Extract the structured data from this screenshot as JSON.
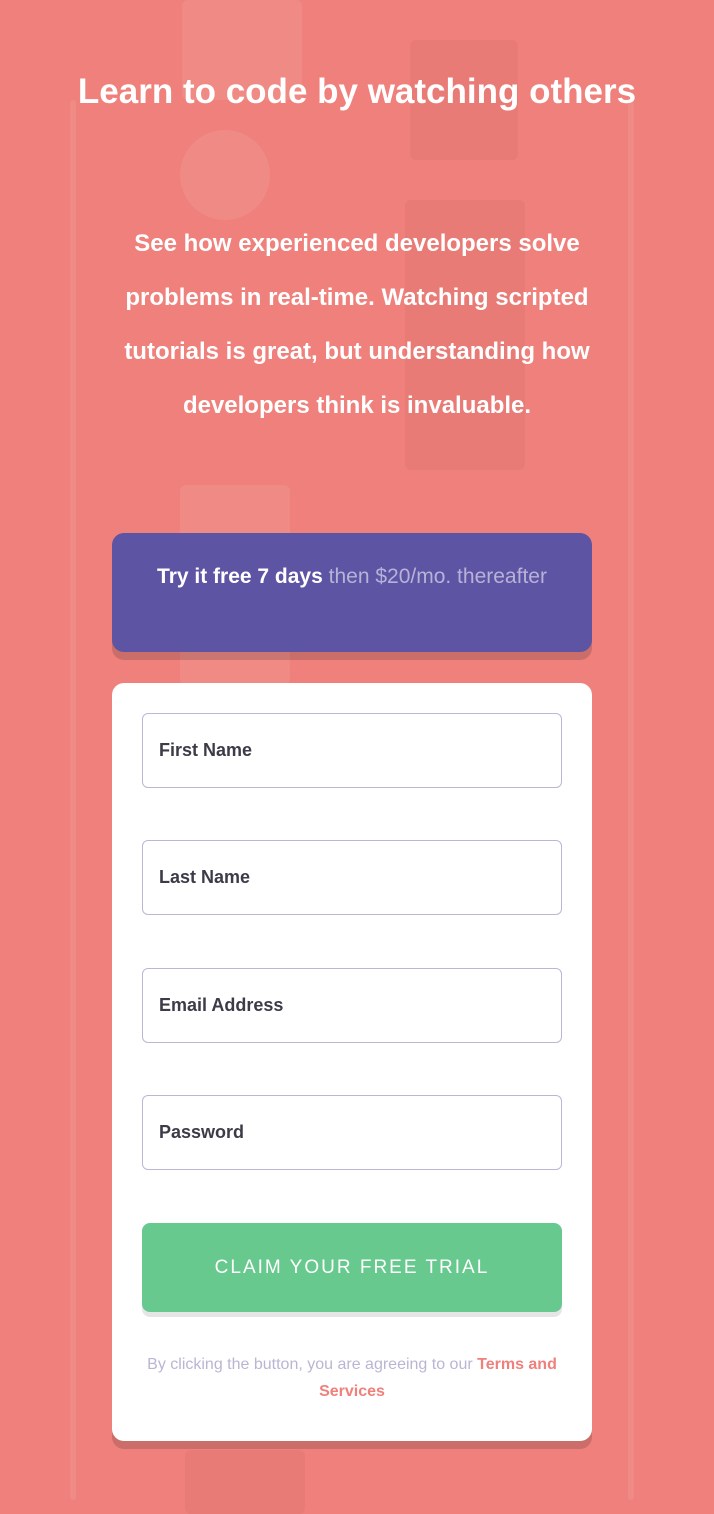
{
  "hero": {
    "title": "Learn to code by watching others",
    "description": "See how experienced developers solve problems in real-time. Watching scripted tutorials is great, but understanding how developers think is invaluable."
  },
  "banner": {
    "bold": "Try it free 7 days",
    "light": "then $20/mo. thereafter"
  },
  "form": {
    "first_name_placeholder": "First Name",
    "last_name_placeholder": "Last Name",
    "email_placeholder": "Email Address",
    "password_placeholder": "Password",
    "submit_label": "CLAIM YOUR FREE TRIAL",
    "legal_text": "By clicking the button, you are agreeing to our",
    "legal_link": "Terms and Services"
  },
  "colors": {
    "background": "#EF807B",
    "banner": "#5E54A4",
    "button": "#68C98F",
    "link": "#EF807B"
  }
}
